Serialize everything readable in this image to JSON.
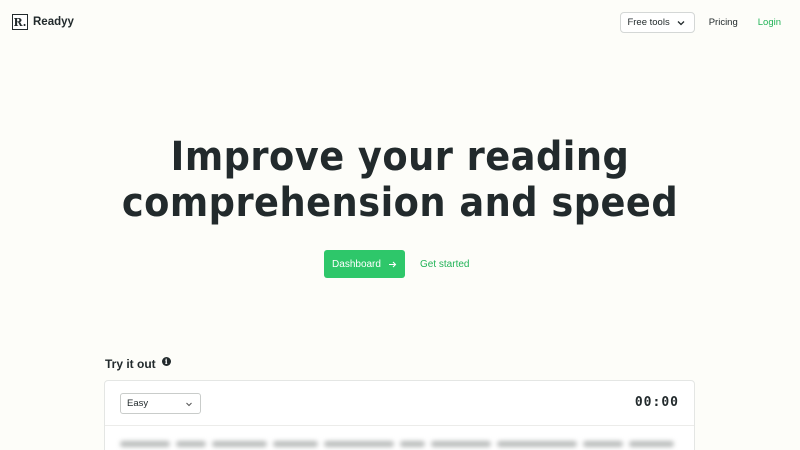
{
  "nav": {
    "logo_mark": "R.",
    "logo_text": "Readyy",
    "free_tools_label": "Free tools",
    "pricing_label": "Pricing",
    "login_label": "Login"
  },
  "hero": {
    "title_line1": "Improve your reading",
    "title_line2": "comprehension and speed",
    "dashboard_label": "Dashboard",
    "get_started_label": "Get started"
  },
  "try_it": {
    "title": "Try it out",
    "difficulty_selected": "Easy",
    "timer": "00:00"
  },
  "colors": {
    "accent": "#2ec76a",
    "link": "#22b358",
    "text": "#222a2c",
    "background": "#fdfdf9"
  },
  "icons": {
    "dropdown": "chevron-down-icon",
    "arrow": "arrow-right-icon",
    "info": "info-icon"
  }
}
